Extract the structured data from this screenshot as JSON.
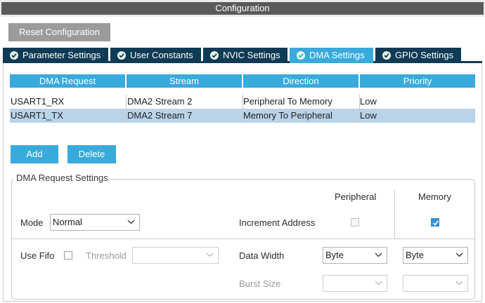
{
  "window": {
    "title": "Configuration"
  },
  "toolbar": {
    "reset_label": "Reset Configuration"
  },
  "tabs": [
    {
      "label": "Parameter Settings",
      "active": false
    },
    {
      "label": "User Constants",
      "active": false
    },
    {
      "label": "NVIC Settings",
      "active": false
    },
    {
      "label": "DMA Settings",
      "active": true
    },
    {
      "label": "GPIO Settings",
      "active": false
    }
  ],
  "table": {
    "headers": [
      "DMA Request",
      "Stream",
      "Direction",
      "Priority"
    ],
    "rows": [
      {
        "request": "USART1_RX",
        "stream": "DMA2 Stream 2",
        "direction": "Peripheral To Memory",
        "priority": "Low",
        "selected": false
      },
      {
        "request": "USART1_TX",
        "stream": "DMA2 Stream 7",
        "direction": "Memory To Peripheral",
        "priority": "Low",
        "selected": true
      }
    ]
  },
  "actions": {
    "add_label": "Add",
    "delete_label": "Delete"
  },
  "settings": {
    "title": "DMA Request Settings",
    "col_peripheral": "Peripheral",
    "col_memory": "Memory",
    "mode_label": "Mode",
    "mode_value": "Normal",
    "increment_label": "Increment Address",
    "peripheral_increment": false,
    "memory_increment": true,
    "fifo_label": "Use Fifo",
    "use_fifo": false,
    "threshold_label": "Threshold",
    "threshold_value": "",
    "data_width_label": "Data Width",
    "peripheral_width": "Byte",
    "memory_width": "Byte",
    "burst_label": "Burst Size",
    "peripheral_burst": "",
    "memory_burst": ""
  },
  "colors": {
    "accent": "#3aa9dc",
    "tab_dark": "#0f3b55",
    "title_bar": "#5a5a5a",
    "reset_button": "#9b9b9b",
    "selected_row": "#b9d3e8"
  },
  "icons": {
    "tab_check": "check-circle-icon",
    "dropdown": "chevron-down-icon",
    "checkbox_check": "check-icon"
  }
}
